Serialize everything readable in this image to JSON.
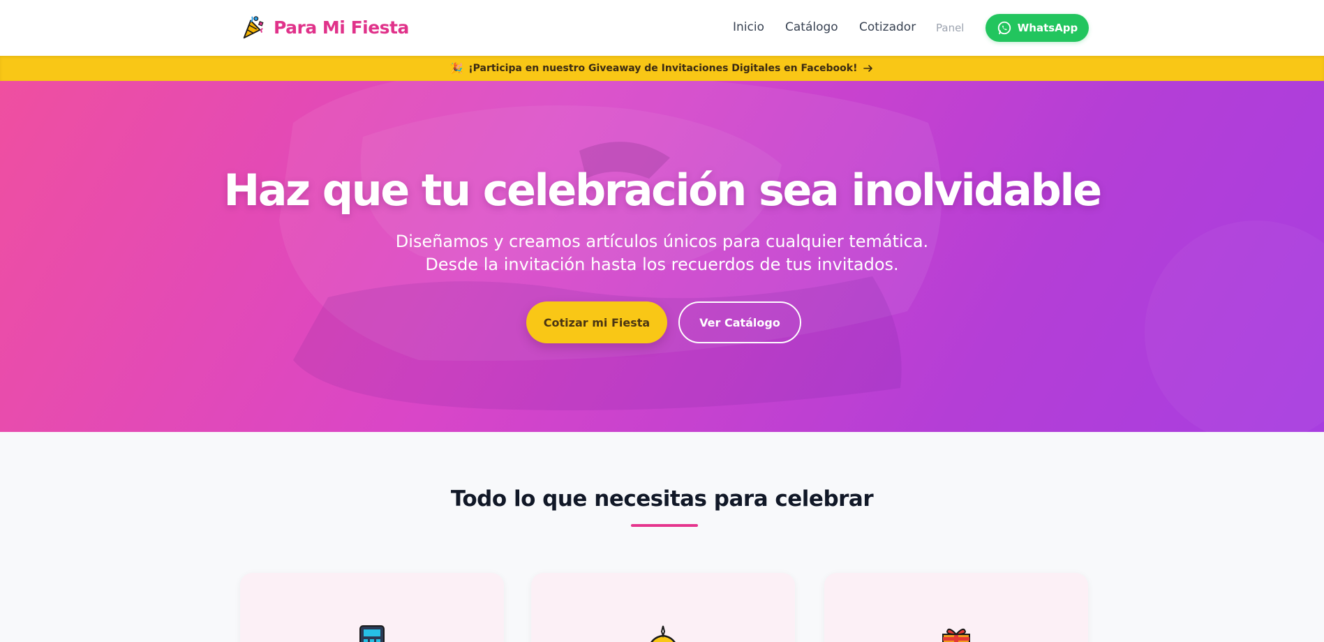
{
  "header": {
    "brand": "Para Mi Fiesta",
    "nav": {
      "inicio": "Inicio",
      "catalogo": "Catálogo",
      "cotizador": "Cotizador",
      "panel": "Panel"
    },
    "whatsapp_label": "WhatsApp"
  },
  "announcement": {
    "icon": "🎉",
    "text": "¡Participa en nuestro Giveaway de Invitaciones Digitales en Facebook!"
  },
  "hero": {
    "title": "Haz que tu celebración sea inolvidable",
    "subtitle_line1": "Diseñamos y creamos artículos únicos para cualquier temática.",
    "subtitle_line2": "Desde la invitación hasta los recuerdos de tus invitados.",
    "primary_button": "Cotizar mi Fiesta",
    "secondary_button": "Ver Catálogo"
  },
  "features": {
    "title": "Todo lo que necesitas para celebrar",
    "cards": [
      {
        "icon": "calculator-icon"
      },
      {
        "icon": "cake-icon"
      },
      {
        "icon": "gift-icon"
      }
    ]
  },
  "colors": {
    "brand_pink": "#e0328a",
    "whatsapp_green": "#22c55e",
    "accent_yellow": "#f9c716",
    "hero_gradient_start": "#ef4fa0",
    "hero_gradient_end": "#a83ee0"
  }
}
